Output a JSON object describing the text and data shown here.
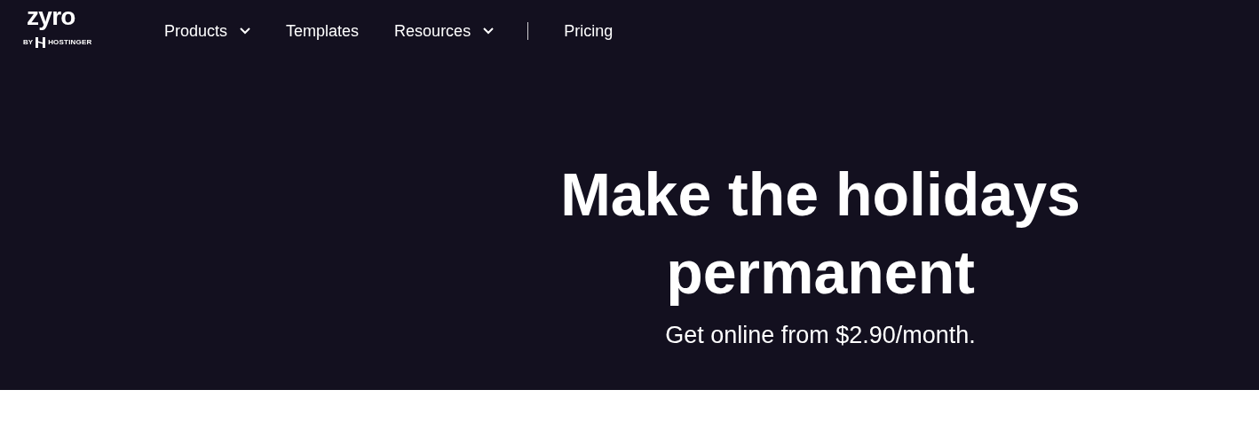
{
  "logo": {
    "wordmark": "zyro",
    "by": "BY",
    "company": "HOSTINGER"
  },
  "nav": [
    {
      "label": "Products",
      "kind": "dropdown"
    },
    {
      "label": "Templates",
      "kind": "link"
    },
    {
      "label": "Resources",
      "kind": "dropdown"
    },
    {
      "label": "Pricing",
      "kind": "link"
    }
  ],
  "hero": {
    "title": "Make the holidays permanent",
    "subtitle": "Get online from $2.90/month."
  }
}
